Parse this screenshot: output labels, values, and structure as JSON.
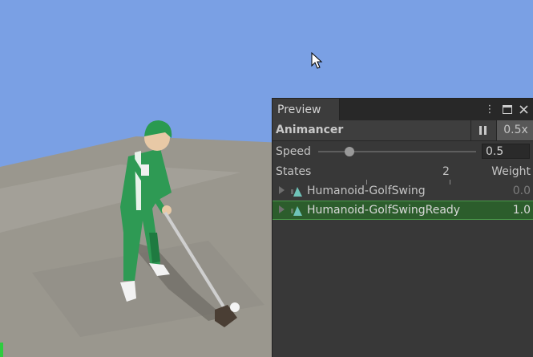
{
  "panel": {
    "tab_label": "Preview",
    "menu_icon": "kebab-menu-icon",
    "maximize_icon": "maximize-icon",
    "close_icon": "close-icon",
    "title": "Animancer",
    "pause_icon": "pause-icon",
    "speed_toggle": "0.5x",
    "speed_label": "Speed",
    "speed_value": "0.5",
    "speed_slider_fraction": 0.2,
    "states_label": "States",
    "states_count": "2",
    "weight_label": "Weight",
    "states": [
      {
        "name": "Humanoid-GolfSwing",
        "weight": "0.0",
        "selected": false
      },
      {
        "name": "Humanoid-GolfSwingReady",
        "weight": "1.0",
        "selected": true
      }
    ]
  },
  "scene": {
    "sky_color": "#7aa0e4",
    "ground_color": "#9a978e",
    "character_color": "#2e9a54"
  },
  "colors": {
    "panel_bg": "#383838",
    "selected_row": "#2c5d2c",
    "selected_border": "#4a9b4a"
  }
}
